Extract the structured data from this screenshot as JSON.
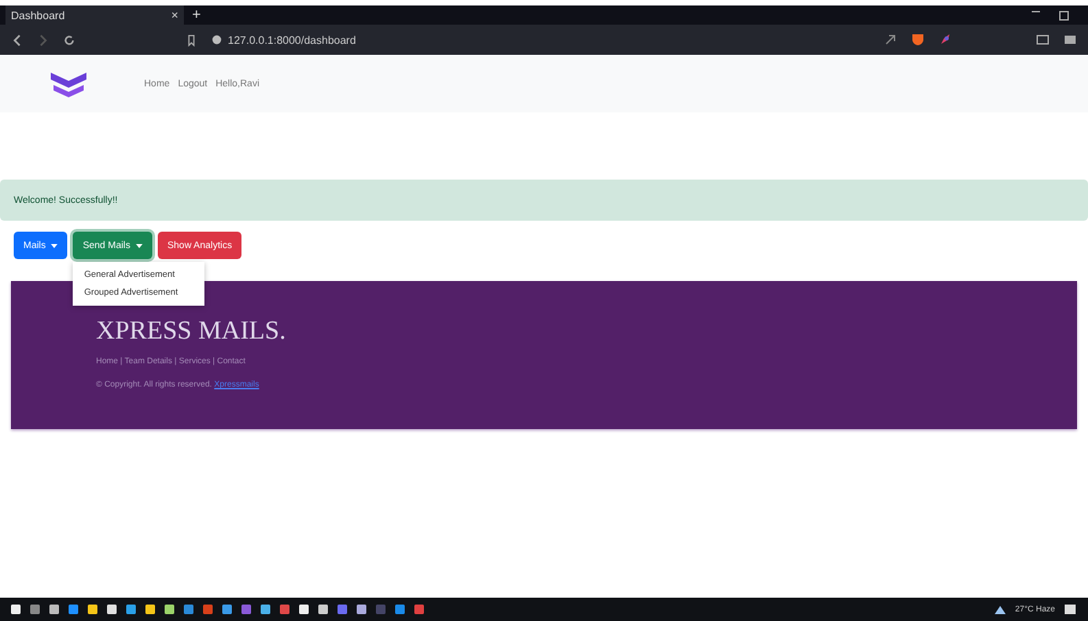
{
  "browser": {
    "tab_title": "Dashboard",
    "tab_close": "×",
    "new_tab": "+",
    "address": "127.0.0.1:8000/dashboard"
  },
  "navbar": {
    "links": [
      "Home",
      "Logout",
      "Hello,Ravi"
    ]
  },
  "alert": {
    "text": "Welcome! Successfully!!"
  },
  "buttons": [
    {
      "label": "Mails",
      "color": "#0d6efd",
      "dropdown": true,
      "expanded": false
    },
    {
      "label": "Send Mails",
      "color": "#198754",
      "dropdown": true,
      "expanded": true
    },
    {
      "label": "Show Analytics",
      "color": "#dc3545",
      "dropdown": false,
      "expanded": false
    }
  ],
  "dropdown_menu": {
    "items": [
      "General Advertisement",
      "Grouped Advertisement"
    ]
  },
  "footer": {
    "brand": "XPRESS MAILS.",
    "links": "Home | Team Details | Services | Contact",
    "copyright": "© Copyright. All rights reserved.",
    "copyright_link": "Xpressmails"
  },
  "taskbar": {
    "weather": "27°C Haze"
  }
}
